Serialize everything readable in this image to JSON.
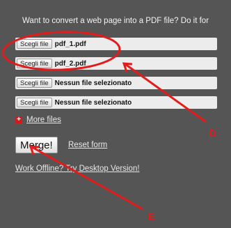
{
  "intro_text": "Want to convert a web page into a PDF file? Do it for",
  "file_rows": [
    {
      "button_label": "Scegli file",
      "file_name": "pdf_1.pdf"
    },
    {
      "button_label": "Scegli file",
      "file_name": "pdf_2.pdf"
    },
    {
      "button_label": "Scegli file",
      "file_name": "Nessun file selezionato"
    },
    {
      "button_label": "Scegli file",
      "file_name": "Nessun file selezionato"
    }
  ],
  "more_files_label": "More files",
  "merge_label": "Merge!",
  "reset_label": "Reset form",
  "offline_label": "Work Offline? Try Desktop Version!",
  "annotations": {
    "label_d": "D",
    "label_e": "E",
    "color": "#e31b1b"
  }
}
